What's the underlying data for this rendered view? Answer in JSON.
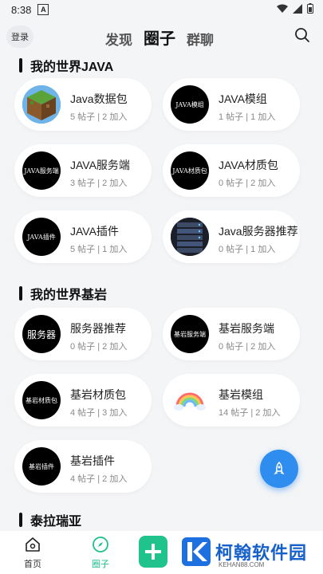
{
  "status": {
    "time": "8:38",
    "a_icon": "A"
  },
  "header": {
    "login": "登录",
    "tabs": [
      {
        "label": "发现"
      },
      {
        "label": "圈子"
      },
      {
        "label": "群聊"
      }
    ]
  },
  "sections": [
    {
      "title": "我的世界JAVA"
    },
    {
      "title": "我的世界基岩"
    },
    {
      "title": "泰拉瑞亚"
    }
  ],
  "cards": [
    {
      "name": "Java数据包",
      "meta": "5 帖子 | 2 加入",
      "icon": "grass-block-icon"
    },
    {
      "name": "JAVA模组",
      "meta": "1 帖子 | 1 加入",
      "logo": "JAVA模组"
    },
    {
      "name": "JAVA服务端",
      "meta": "3 帖子 | 2 加入",
      "logo": "JAVA服务端"
    },
    {
      "name": "JAVA材质包",
      "meta": "0 帖子 | 2 加入",
      "logo": "JAVA材质包"
    },
    {
      "name": "JAVA插件",
      "meta": "5 帖子 | 1 加入",
      "logo": "JAVA插件"
    },
    {
      "name": "Java服务器推荐",
      "meta": "0 帖子 | 1 加入",
      "icon": "server-rack-icon"
    },
    {
      "name": "服务器推荐",
      "meta": "0 帖子 | 2 加入",
      "logo": "服务器"
    },
    {
      "name": "基岩服务端",
      "meta": "0 帖子 | 2 加入",
      "logo": "基岩服务端"
    },
    {
      "name": "基岩材质包",
      "meta": "4 帖子 | 3 加入",
      "logo": "基岩材质包"
    },
    {
      "name": "基岩模组",
      "meta": "14 帖子 | 2 加入",
      "icon": "rainbow-icon"
    },
    {
      "name": "基岩插件",
      "meta": "4 帖子 | 2 加入",
      "logo": "基岩插件"
    }
  ],
  "nav": [
    {
      "label": "首页",
      "icon": "home-icon"
    },
    {
      "label": "圈子",
      "icon": "compass-icon"
    }
  ],
  "watermark": {
    "title": "柯翰软件园",
    "sub": "KEHAN88.COM"
  },
  "colors": {
    "accent": "#20c38c",
    "fab": "#2f8df0",
    "watermark": "#1660c9"
  }
}
